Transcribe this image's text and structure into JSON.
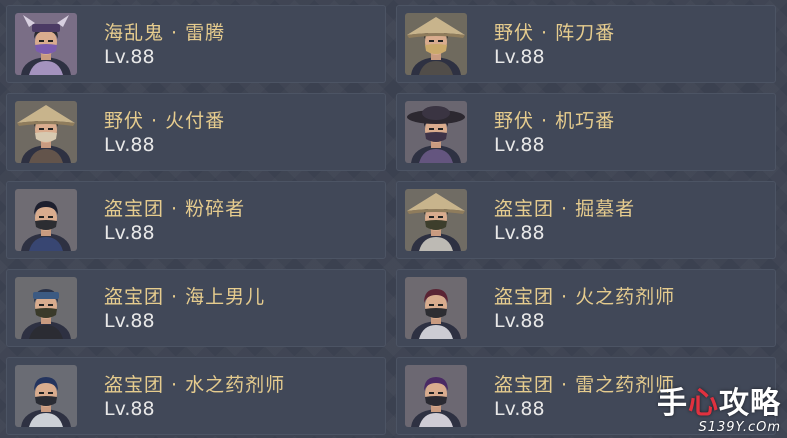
{
  "enemies": [
    {
      "name": "海乱鬼 · 雷腾",
      "level": "Lv.88",
      "portrait_bg": "#7a6e86",
      "hat": "oni",
      "mask": "#7b5cae",
      "hair": "#2a2a30",
      "scarf": "#b8a4d4"
    },
    {
      "name": "野伏 · 阵刀番",
      "level": "Lv.88",
      "portrait_bg": "#6f6a5e",
      "hat": "straw",
      "mask": "#caa96a",
      "hair": "#2a2420",
      "scarf": "#57524a"
    },
    {
      "name": "野伏 · 火付番",
      "level": "Lv.88",
      "portrait_bg": "#6f6a62",
      "hat": "straw",
      "mask": "#d7c9b0",
      "hair": "#2a2420",
      "scarf": "#6c5b4c"
    },
    {
      "name": "野伏 · 机巧番",
      "level": "Lv.88",
      "portrait_bg": "#6a6670",
      "hat": "dark",
      "mask": "#3e3348",
      "hair": "#1f1c24",
      "scarf": "#6d5c8a"
    },
    {
      "name": "盗宝团 · 粉碎者",
      "level": "Lv.88",
      "portrait_bg": "#6f6c73",
      "hat": "none",
      "mask": "#2c2d32",
      "hair": "#1d1f2e",
      "scarf": "#3a4a7a"
    },
    {
      "name": "盗宝团 · 掘墓者",
      "level": "Lv.88",
      "portrait_bg": "#706c64",
      "hat": "straw",
      "mask": "#3d3e2c",
      "hair": "#2a2620",
      "scarf": "#d6d2c8"
    },
    {
      "name": "盗宝团 · 海上男儿",
      "level": "Lv.88",
      "portrait_bg": "#6c6c70",
      "hat": "band",
      "mask": "#3a3a2a",
      "hair": "#2a3248",
      "scarf": "#2a2c30"
    },
    {
      "name": "盗宝团 · 火之药剂师",
      "level": "Lv.88",
      "portrait_bg": "#6e6a70",
      "hat": "none",
      "mask": "#2d2d32",
      "hair": "#5a2434",
      "scarf": "#e8e8ec"
    },
    {
      "name": "盗宝团 · 水之药剂师",
      "level": "Lv.88",
      "portrait_bg": "#6a6c74",
      "hat": "none",
      "mask": "#2a2c34",
      "hair": "#24345e",
      "scarf": "#e8ecf0"
    },
    {
      "name": "盗宝团 · 雷之药剂师",
      "level": "Lv.88",
      "portrait_bg": "#6c6872",
      "hat": "none",
      "mask": "#2a2a32",
      "hair": "#4a2a64",
      "scarf": "#ebe8ef"
    }
  ],
  "watermark": {
    "title_a": "手",
    "title_heart": "心",
    "title_b": "攻略",
    "url": "S139Y.cOm"
  }
}
